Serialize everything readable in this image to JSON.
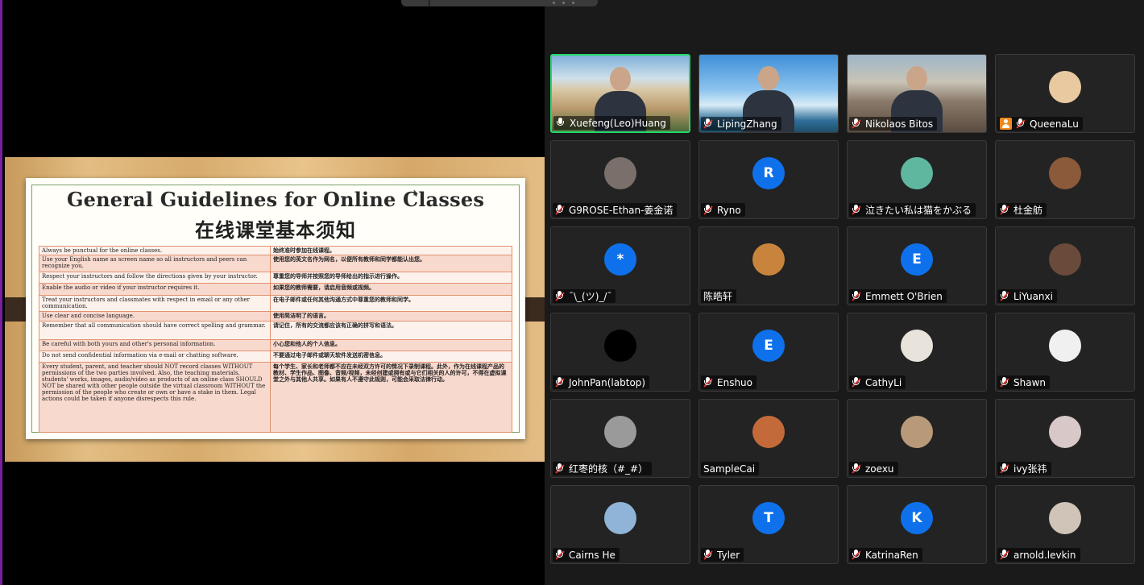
{
  "slide": {
    "title_en": "General Guidelines for Online Classes",
    "title_zh": "在线课堂基本须知",
    "rules": [
      {
        "en": "Always be punctual for the online classes.",
        "zh": "始终准时参加在线课程。"
      },
      {
        "en": "Use your English name as screen name so all instructors and peers can recognize you.",
        "zh": "使用您的英文名作为网名，以便所有教师和同学都能认出您。"
      },
      {
        "en": "Respect your instructors and follow the directions given by your instructor.",
        "zh": "尊重您的导师并按照您的导师给出的指示进行操作。"
      },
      {
        "en": "Enable the audio or video if your instructor requires it.",
        "zh": "如果您的教师需要，请启用音频或视频。"
      },
      {
        "en": "Treat your instructors and classmates with respect in email or any other communication.",
        "zh": "在电子邮件或任何其他沟通方式中尊重您的教师和同学。"
      },
      {
        "en": "Use clear and concise language.",
        "zh": "使用简洁明了的语言。"
      },
      {
        "en": "Remember that all communication should have correct spelling and grammar.",
        "zh": "请记住，所有的交流都应该有正确的拼写和语法。"
      },
      {
        "en": "Be careful with both yours and other's personal information.",
        "zh": "小心您和他人的个人信息。"
      },
      {
        "en": "Do not send confidential information via e-mail or chatting software.",
        "zh": "不要通过电子邮件或聊天软件发送机密信息。"
      },
      {
        "en": "Every student, parent, and teacher should NOT record classes WITHOUT permissions of the two parties involved. Also, the teaching materials, students' works, images, audio/video as products of an online class SHOULD NOT be shared with other people outside the virtual classroom WITHOUT the permission of the people who create or own or have a stake in them. Legal actions could be taken if anyone disrespects this rule.",
        "zh": "每个学生、家长和老师都不应在未经双方许可的情况下录制课程。此外，作为在线课程产品的教材、学生作品、图像、音频/视频，未经创建或拥有或与它们相关的人的许可，不得在虚拟课堂之外与其他人共享。如果有人不遵守此规则，可能会采取法律行动。"
      }
    ]
  },
  "participants": [
    {
      "name": "Xuefeng(Leo)Huang",
      "mic": "live",
      "type": "video",
      "scene": "building",
      "active": true
    },
    {
      "name": "LipingZhang",
      "mic": "muted",
      "type": "video",
      "scene": "sky"
    },
    {
      "name": "Nikolaos Bitos",
      "mic": "muted",
      "type": "video",
      "scene": "rocks"
    },
    {
      "name": "QueenaLu",
      "mic": "muted",
      "type": "avatar",
      "avatar_color": "#e9c9a0",
      "badge": true
    },
    {
      "name": "G9ROSE-Ethan-姜金诺",
      "mic": "muted",
      "type": "avatar",
      "avatar_color": "#7a6f6a"
    },
    {
      "name": "Ryno",
      "mic": "muted",
      "type": "letter",
      "letter": "R",
      "avatar_color": "#0e71eb"
    },
    {
      "name": "泣きたい私は猫をかぶる",
      "mic": "muted",
      "type": "avatar",
      "avatar_color": "#5fb7a0"
    },
    {
      "name": "杜金舫",
      "mic": "muted",
      "type": "avatar",
      "avatar_color": "#8a5a3a"
    },
    {
      "name": "¯\\_(ツ)_/¯",
      "mic": "muted",
      "type": "letter",
      "letter": "*",
      "avatar_color": "#0e71eb"
    },
    {
      "name": "陈皓轩",
      "mic": "none",
      "type": "avatar",
      "avatar_color": "#c8843c"
    },
    {
      "name": "Emmett O'Brien",
      "mic": "muted",
      "type": "letter",
      "letter": "E",
      "avatar_color": "#0e71eb"
    },
    {
      "name": "LiYuanxi",
      "mic": "muted",
      "type": "avatar",
      "avatar_color": "#6a4a3a"
    },
    {
      "name": "JohnPan(labtop)",
      "mic": "muted",
      "type": "avatar",
      "avatar_color": "#000000"
    },
    {
      "name": "Enshuo",
      "mic": "muted",
      "type": "letter",
      "letter": "E",
      "avatar_color": "#0e71eb"
    },
    {
      "name": "CathyLi",
      "mic": "muted",
      "type": "avatar",
      "avatar_color": "#e8e4dc"
    },
    {
      "name": "Shawn",
      "mic": "muted",
      "type": "avatar",
      "avatar_color": "#f0f0f0"
    },
    {
      "name": "红枣的核（#_#）",
      "mic": "muted",
      "type": "avatar",
      "avatar_color": "#9a9a9a"
    },
    {
      "name": "SampleCai",
      "mic": "none",
      "type": "avatar",
      "avatar_color": "#c46a3a"
    },
    {
      "name": "zoexu",
      "mic": "muted",
      "type": "avatar",
      "avatar_color": "#b89a7a"
    },
    {
      "name": "ivy张祎",
      "mic": "muted",
      "type": "avatar",
      "avatar_color": "#d8c8c8"
    },
    {
      "name": "Cairns He",
      "mic": "muted",
      "type": "avatar",
      "avatar_color": "#8fb4d8"
    },
    {
      "name": "Tyler",
      "mic": "muted",
      "type": "letter",
      "letter": "T",
      "avatar_color": "#0e71eb"
    },
    {
      "name": "KatrinaRen",
      "mic": "muted",
      "type": "letter",
      "letter": "K",
      "avatar_color": "#0e71eb"
    },
    {
      "name": "arnold.levkin",
      "mic": "muted",
      "type": "avatar",
      "avatar_color": "#d0c4b8"
    }
  ]
}
